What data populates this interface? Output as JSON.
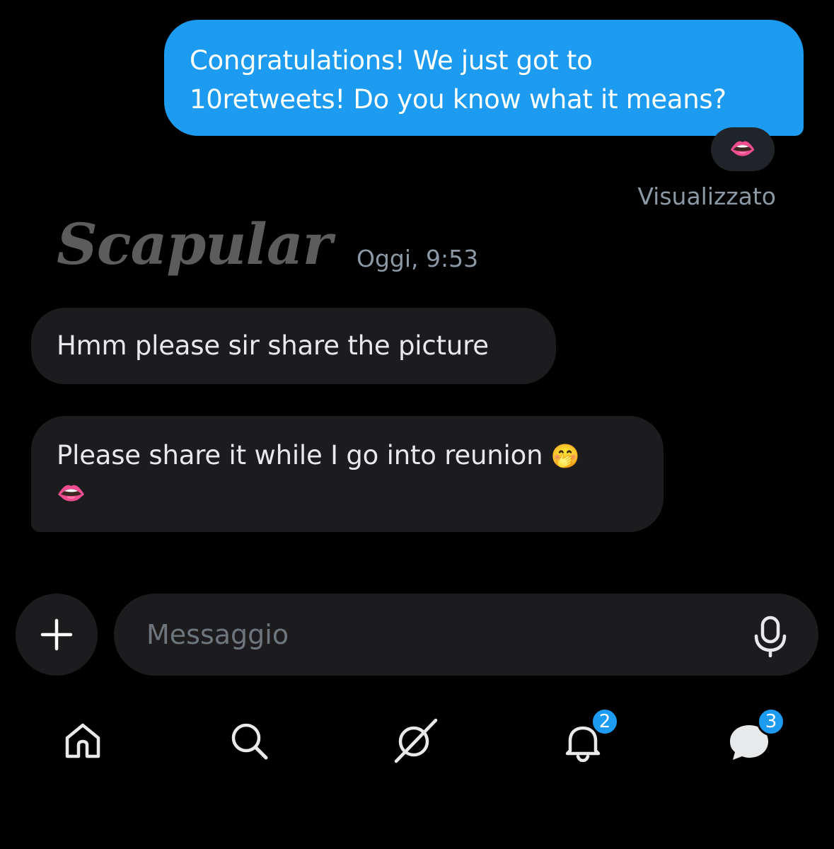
{
  "conversation": {
    "outgoing": {
      "line1": "Congratulations! We just got to",
      "line2": "10retweets! Do you know what it means?",
      "reaction": "👄",
      "status": "Visualizzato"
    },
    "sender": {
      "name": "Scapular",
      "time": "Oggi, 9:53"
    },
    "incoming": [
      {
        "text": "Hmm please sir share the picture"
      },
      {
        "line1": "Please share it while I go into reunion",
        "emoji1": "🤭",
        "line2_emoji": "👄"
      }
    ]
  },
  "composer": {
    "placeholder": "Messaggio",
    "add_icon": "plus-icon",
    "mic_icon": "microphone-icon"
  },
  "nav": {
    "items": [
      {
        "icon": "home-icon"
      },
      {
        "icon": "search-icon"
      },
      {
        "icon": "grok-icon"
      },
      {
        "icon": "bell-icon",
        "badge": "2"
      },
      {
        "icon": "messages-icon",
        "badge": "3"
      }
    ]
  },
  "colors": {
    "accent": "#1d9bf0",
    "bubble_in": "#1c1c1e",
    "background": "#000000",
    "muted_text": "#8b98a5"
  }
}
